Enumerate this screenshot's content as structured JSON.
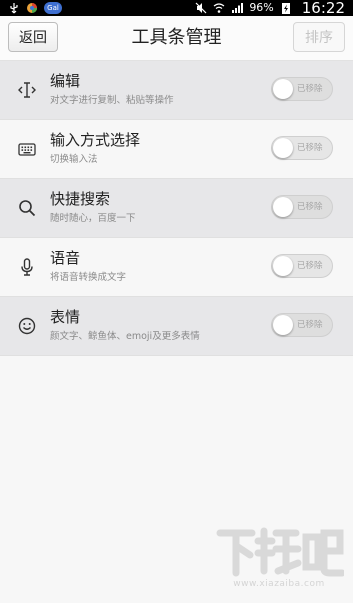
{
  "status_bar": {
    "battery": "96%",
    "time": "16:22",
    "badge_text": "Gal"
  },
  "header": {
    "back_label": "返回",
    "title": "工具条管理",
    "sort_label": "排序"
  },
  "items": [
    {
      "icon": "text-cursor-icon",
      "title": "编辑",
      "subtitle": "对文字进行复制、粘贴等操作",
      "toggle_label": "已移除"
    },
    {
      "icon": "keyboard-icon",
      "title": "输入方式选择",
      "subtitle": "切换输入法",
      "toggle_label": "已移除"
    },
    {
      "icon": "search-icon",
      "title": "快捷搜索",
      "subtitle": "随时随心，百度一下",
      "toggle_label": "已移除"
    },
    {
      "icon": "microphone-icon",
      "title": "语音",
      "subtitle": "将语音转换成文字",
      "toggle_label": "已移除"
    },
    {
      "icon": "smiley-icon",
      "title": "表情",
      "subtitle": "颜文字、鲸鱼体、emoji及更多表情",
      "toggle_label": "已移除"
    }
  ],
  "watermark": {
    "logo_text": "下载吧",
    "url": "www.xiazaiba.com"
  },
  "colors": {
    "row_alt": "#e7e7e9",
    "row_plain": "#f7f7f7",
    "text_primary": "#222222",
    "text_secondary": "#8a8a8a"
  }
}
